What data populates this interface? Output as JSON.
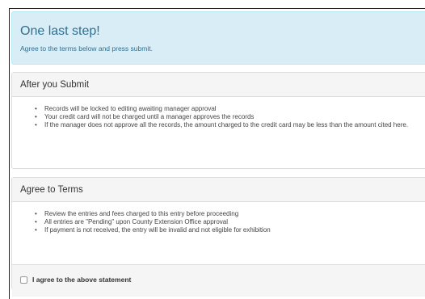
{
  "alert": {
    "title": "One last step!",
    "subtitle": "Agree to the terms below and press submit."
  },
  "after_submit": {
    "heading": "After you Submit",
    "items": [
      "Records will be locked to editing awaiting manager approval",
      "Your credit card will not be charged until a manager approves the records",
      "If the manager does not approve all the records, the amount charged to the credit card may be less than the amount cited here."
    ]
  },
  "terms": {
    "heading": "Agree to Terms",
    "items": [
      "Review the entries and fees charged to this entry before proceeding",
      "All entries are \"Pending\" upon County Extension Office approval",
      "If payment is not received, the entry will be invalid and not eligible for exhibition"
    ],
    "agree_label": "I agree to the above statement"
  },
  "colors": {
    "alert_bg": "#d9edf7",
    "alert_text": "#31708f",
    "panel_heading_bg": "#f5f5f5"
  }
}
